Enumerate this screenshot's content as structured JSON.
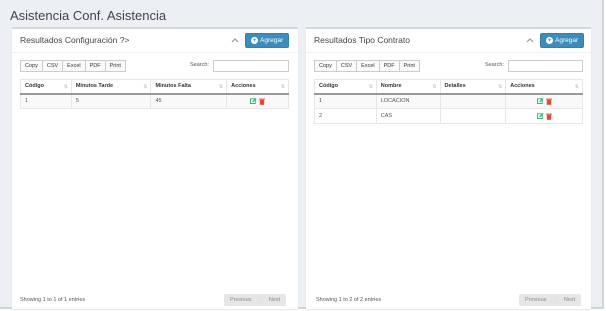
{
  "page": {
    "title": "Asistencia Conf. Asistencia"
  },
  "left_panel": {
    "title": "Resultados Configuración ?>",
    "add_label": "Agregar",
    "buttons": [
      "Copy",
      "CSV",
      "Excel",
      "PDF",
      "Print"
    ],
    "search_label": "Search:",
    "columns": [
      "Código",
      "Minutos Tarde",
      "Minutos Falta",
      "Acciones"
    ],
    "rows": [
      [
        "1",
        "5",
        "45"
      ]
    ],
    "info": "Showing 1 to 1 of 1 entries",
    "prev": "Previous",
    "next": "Next"
  },
  "right_panel": {
    "title": "Resultados Tipo Contrato",
    "add_label": "Agregar",
    "buttons": [
      "Copy",
      "CSV",
      "Excel",
      "PDF",
      "Print"
    ],
    "search_label": "Search:",
    "columns": [
      "Código",
      "Nombre",
      "Detalles",
      "Acciones"
    ],
    "rows": [
      [
        "1",
        "LOCACION",
        ""
      ],
      [
        "2",
        "CAS",
        ""
      ]
    ],
    "info": "Showing 1 to 2 of 2 entries",
    "prev": "Previous",
    "next": "Next"
  },
  "colors": {
    "primary": "#3c8dbc",
    "edit": "#00a65a",
    "delete": "#dd4b39"
  }
}
